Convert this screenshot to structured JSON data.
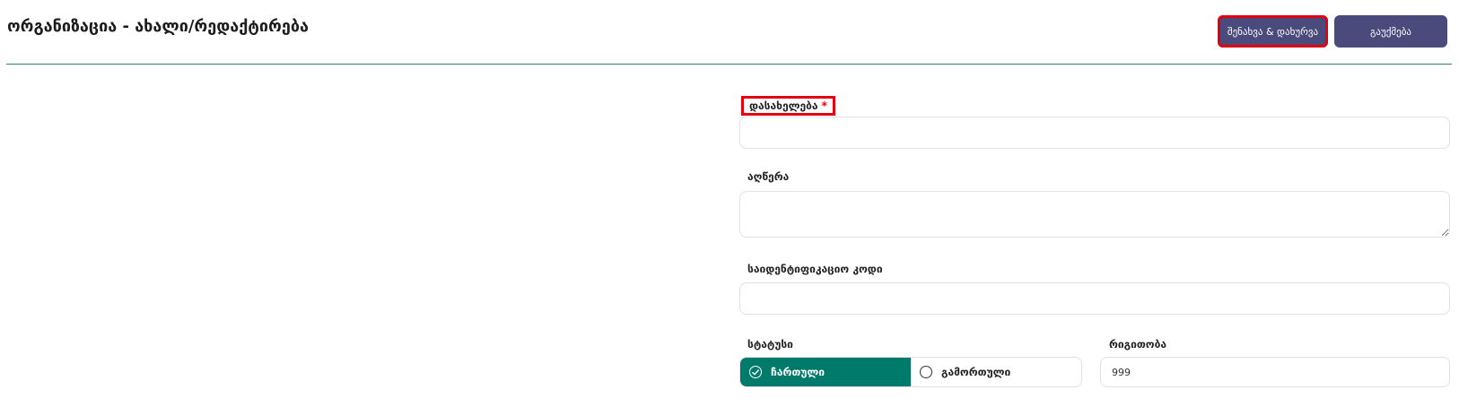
{
  "header": {
    "title": "ორგანიზაცია - ახალი/რედაქტირება",
    "save_close_label": "შენახვა & დახურვა",
    "cancel_label": "გაუქმება"
  },
  "form": {
    "name": {
      "label": "დასახელება",
      "required_mark": "*",
      "value": ""
    },
    "description": {
      "label": "აღწერა",
      "value": ""
    },
    "identification_code": {
      "label": "საიდენტიფიკაციო კოდი",
      "value": ""
    },
    "status": {
      "label": "სტატუსი",
      "options": [
        {
          "label": "ჩართული",
          "selected": true
        },
        {
          "label": "გამორთული",
          "selected": false
        }
      ]
    },
    "order": {
      "label": "რიგითობა",
      "value": "999"
    }
  },
  "colors": {
    "primary_button": "#4a4a7c",
    "accent_teal": "#007a6a",
    "divider": "#2f7f72",
    "highlight_red": "#e0000f"
  },
  "icons": {
    "selected_radio": "check-circle-icon",
    "unselected_radio": "empty-circle-icon"
  }
}
